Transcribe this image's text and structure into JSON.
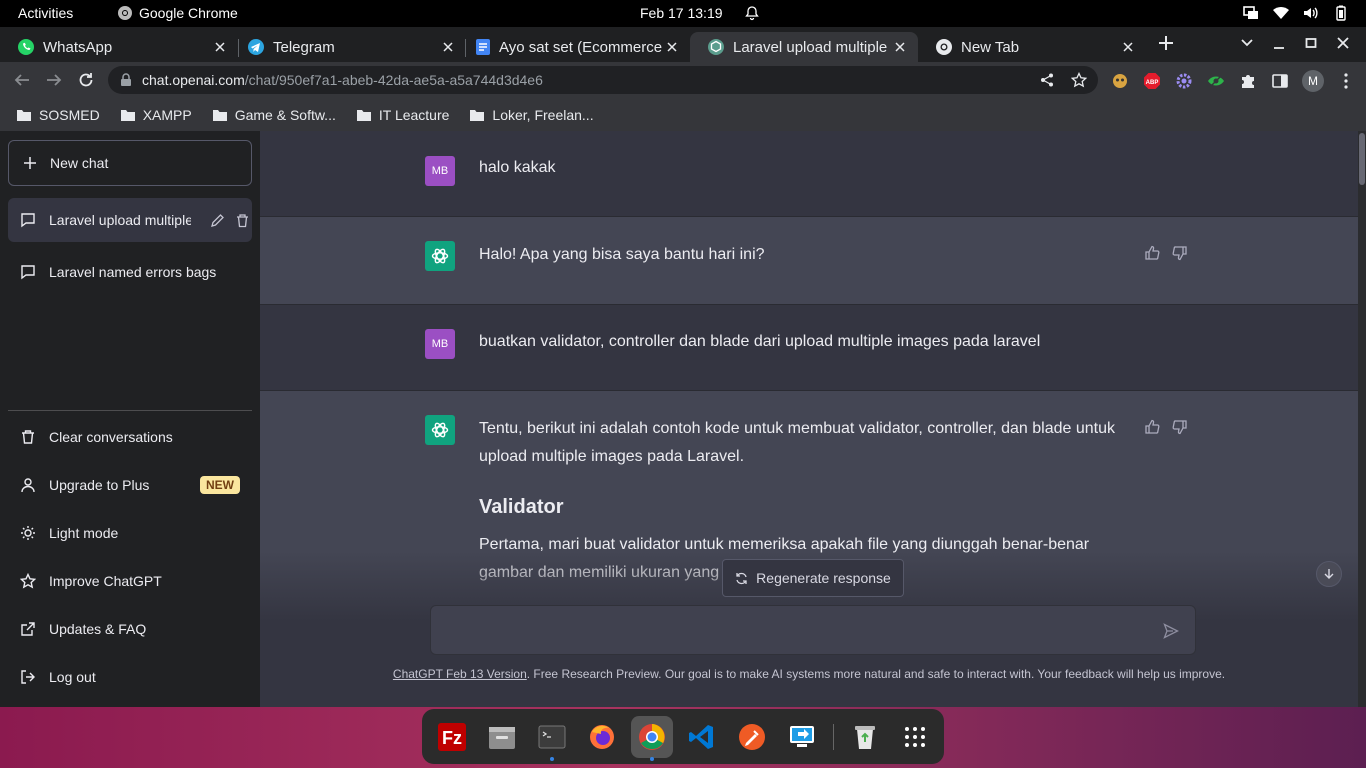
{
  "system": {
    "activities": "Activities",
    "app_name": "Google Chrome",
    "clock": "Feb 17  13:19"
  },
  "tabs": [
    {
      "title": "WhatsApp",
      "icon": "whatsapp-icon"
    },
    {
      "title": "Telegram",
      "icon": "telegram-icon"
    },
    {
      "title": "Ayo sat set (Ecommerce",
      "icon": "google-docs-icon"
    },
    {
      "title": "Laravel upload multiple",
      "icon": "openai-icon",
      "active": true
    },
    {
      "title": "New Tab",
      "icon": "chrome-icon"
    }
  ],
  "address": {
    "host": "chat.openai.com",
    "path": "/chat/950ef7a1-abeb-42da-ae5a-a5a744d3d4e6"
  },
  "profile_initial": "M",
  "bookmarks": [
    "SOSMED",
    "XAMPP",
    "Game & Softw...",
    "IT Leacture",
    "Loker, Freelan..."
  ],
  "sidebar": {
    "new_chat": "New chat",
    "conversations": [
      {
        "label": "Laravel upload multiple images",
        "selected": true
      },
      {
        "label": "Laravel named errors bags",
        "selected": false
      }
    ],
    "menu": [
      {
        "label": "Clear conversations",
        "icon": "trash-icon"
      },
      {
        "label": "Upgrade to Plus",
        "icon": "user-icon",
        "badge": "NEW"
      },
      {
        "label": "Light mode",
        "icon": "sun-icon"
      },
      {
        "label": "Improve ChatGPT",
        "icon": "star-icon"
      },
      {
        "label": "Updates & FAQ",
        "icon": "external-link-icon"
      },
      {
        "label": "Log out",
        "icon": "logout-icon"
      }
    ]
  },
  "chat": {
    "user_initials": "MB",
    "messages": [
      {
        "role": "user",
        "text": "halo kakak"
      },
      {
        "role": "assistant",
        "text": "Halo! Apa yang bisa saya bantu hari ini?"
      },
      {
        "role": "user",
        "text": "buatkan validator, controller dan blade dari upload multiple images pada laravel"
      },
      {
        "role": "assistant",
        "text": "Tentu, berikut ini adalah contoh kode untuk membuat validator, controller, dan blade untuk upload multiple images pada Laravel.",
        "heading": "Validator",
        "para": "Pertama, mari buat validator untuk memeriksa apakah file yang diunggah benar-benar gambar dan memiliki ukuran yang"
      }
    ],
    "regenerate": "Regenerate response",
    "footer_link": "ChatGPT Feb 13 Version",
    "footer_text": ". Free Research Preview. Our goal is to make AI systems more natural and safe to interact with. Your feedback will help us improve."
  },
  "dock": [
    "filezilla-icon",
    "files-icon",
    "terminal-icon",
    "firefox-icon",
    "chrome-icon",
    "vscode-icon",
    "postman-icon",
    "remote-desktop-icon",
    "trash-icon",
    "app-grid-icon"
  ]
}
